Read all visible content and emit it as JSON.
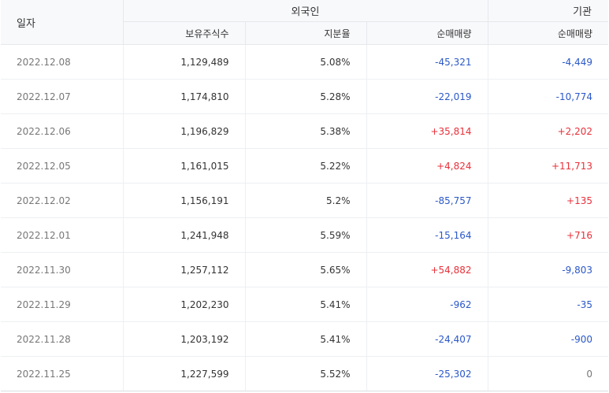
{
  "header": {
    "date": "일자",
    "foreign": "외국인",
    "institution": "기관",
    "holdings": "보유주식수",
    "share": "지분율",
    "foreign_net": "순매매량",
    "inst_net": "순매매량"
  },
  "rows": [
    {
      "date": "2022.12.08",
      "holdings": "1,129,489",
      "share": "5.08%",
      "foreign_net": "-45,321",
      "inst_net": "-4,449"
    },
    {
      "date": "2022.12.07",
      "holdings": "1,174,810",
      "share": "5.28%",
      "foreign_net": "-22,019",
      "inst_net": "-10,774"
    },
    {
      "date": "2022.12.06",
      "holdings": "1,196,829",
      "share": "5.38%",
      "foreign_net": "+35,814",
      "inst_net": "+2,202"
    },
    {
      "date": "2022.12.05",
      "holdings": "1,161,015",
      "share": "5.22%",
      "foreign_net": "+4,824",
      "inst_net": "+11,713"
    },
    {
      "date": "2022.12.02",
      "holdings": "1,156,191",
      "share": "5.2%",
      "foreign_net": "-85,757",
      "inst_net": "+135"
    },
    {
      "date": "2022.12.01",
      "holdings": "1,241,948",
      "share": "5.59%",
      "foreign_net": "-15,164",
      "inst_net": "+716"
    },
    {
      "date": "2022.11.30",
      "holdings": "1,257,112",
      "share": "5.65%",
      "foreign_net": "+54,882",
      "inst_net": "-9,803"
    },
    {
      "date": "2022.11.29",
      "holdings": "1,202,230",
      "share": "5.41%",
      "foreign_net": "-962",
      "inst_net": "-35"
    },
    {
      "date": "2022.11.28",
      "holdings": "1,203,192",
      "share": "5.41%",
      "foreign_net": "-24,407",
      "inst_net": "-900"
    },
    {
      "date": "2022.11.25",
      "holdings": "1,227,599",
      "share": "5.52%",
      "foreign_net": "-25,302",
      "inst_net": "0"
    }
  ],
  "colors": {
    "negative": "#2b58c8",
    "positive": "#e8313a",
    "neutral": "#777777",
    "header_bg": "#f8f9fb"
  }
}
